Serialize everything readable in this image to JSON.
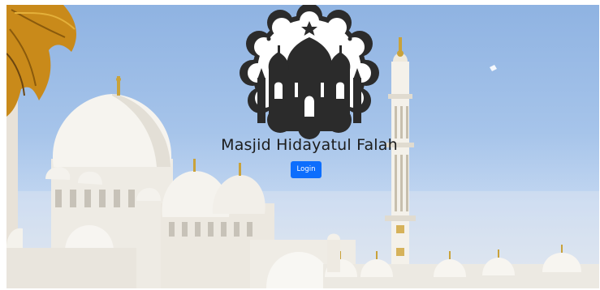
{
  "site": {
    "title": "Masjid Hidayatul Falah"
  },
  "actions": {
    "login_label": "Login"
  },
  "colors": {
    "sky": "#9dbce6",
    "logo": "#2b2b2b",
    "button": "#0d6efd",
    "button_text": "#ffffff"
  },
  "icons": {
    "logo": "mosque-icon"
  }
}
